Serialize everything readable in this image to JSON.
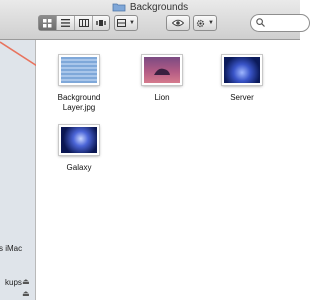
{
  "window": {
    "title": "Backgrounds",
    "folder_icon": "folder-icon"
  },
  "toolbar": {
    "view_buttons": [
      "icon-view",
      "list-view",
      "column-view"
    ],
    "arrange_icon": "arrange-icon",
    "quicklook_icon": "eye-icon",
    "action_icon": "gear-icon",
    "search_icon": "search-icon"
  },
  "sidebar": {
    "items": [
      {
        "label": "s iMac"
      },
      {
        "label": "kups"
      }
    ]
  },
  "files": [
    {
      "name": "Background Layer.jpg",
      "thumb": "striped-blue"
    },
    {
      "name": "Lion",
      "thumb": "lion-wallpaper"
    },
    {
      "name": "Server",
      "thumb": "server-galaxy"
    },
    {
      "name": "Galaxy",
      "thumb": "galaxy"
    }
  ],
  "colors": {
    "sidebar_bg": "#dfe4ea",
    "annotation_arrow": "#e8735e",
    "toolbar_active": "#7a7a7a"
  }
}
